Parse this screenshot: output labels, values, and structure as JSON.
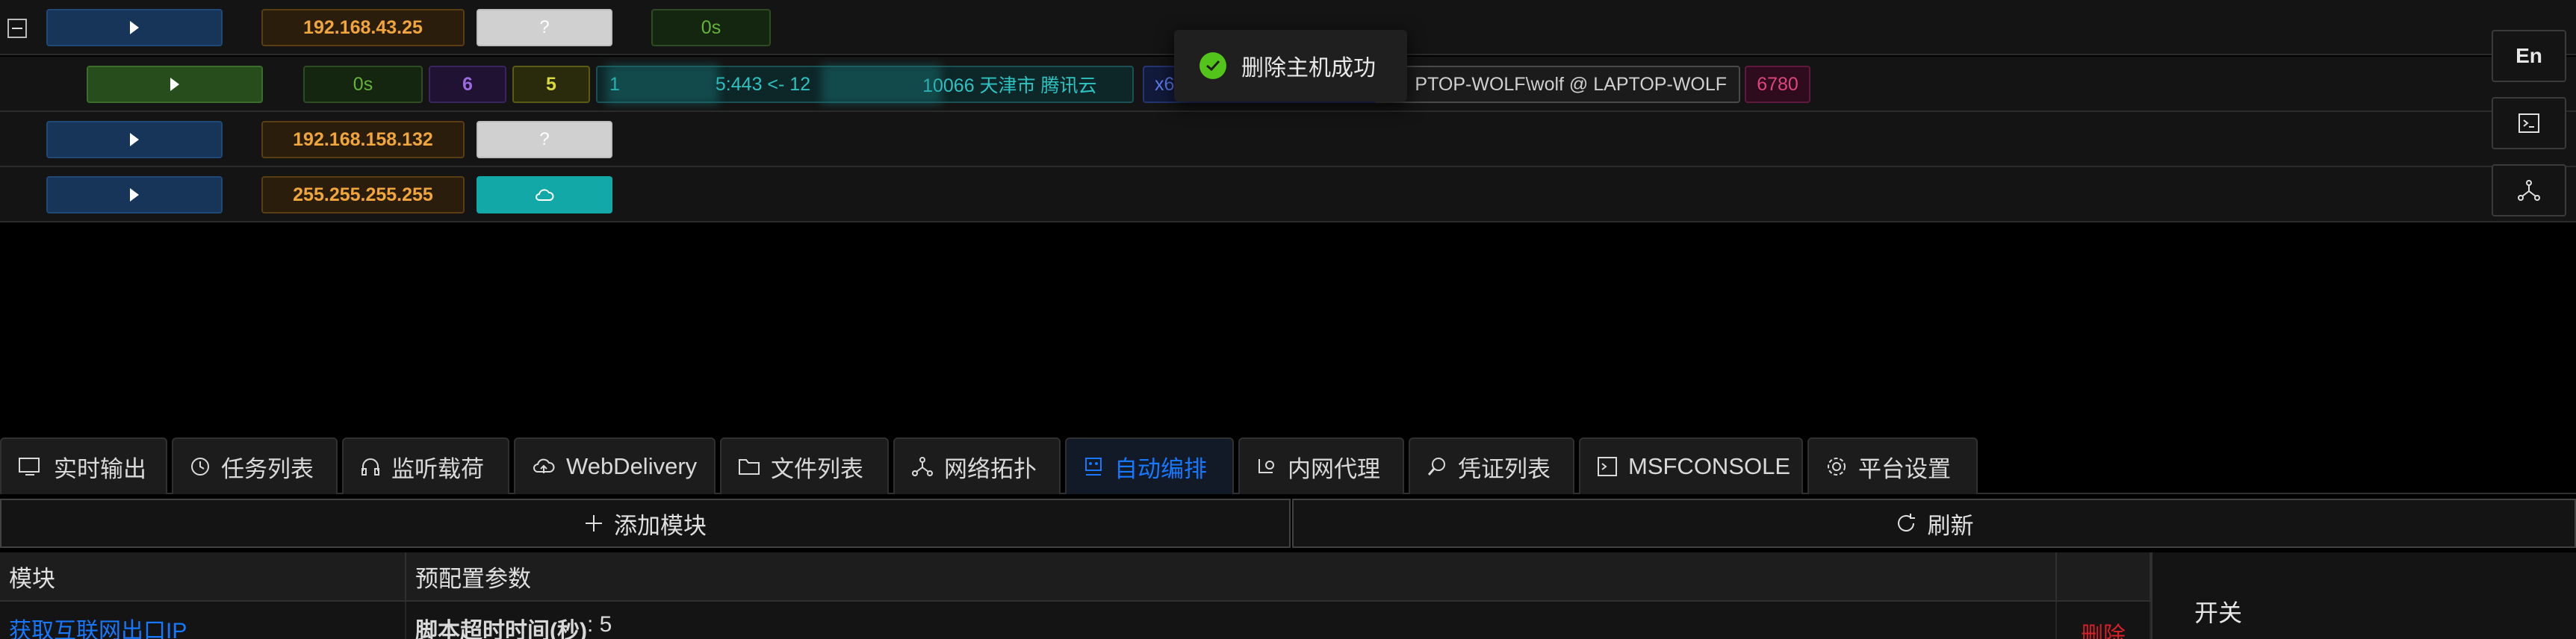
{
  "hosts": [
    {
      "ip": "192.168.43.25",
      "os": "?",
      "time": "0s"
    },
    {
      "session": {
        "time": "0s",
        "a": "6",
        "b": "5",
        "addr_prefix": "1",
        "addr_mid": "5:443 <- 12",
        "addr_suffix": "10066 天津市 腾讯云",
        "arch": "x6",
        "user": "PTOP-WOLF\\wolf @ LAPTOP-WOLF",
        "pid": "6780"
      }
    },
    {
      "ip": "192.168.158.132",
      "os": "?"
    },
    {
      "ip": "255.255.255.255",
      "os": "cloud"
    }
  ],
  "toast": {
    "text": "删除主机成功"
  },
  "side": {
    "lang": "En"
  },
  "tabs": [
    {
      "label": "实时输出"
    },
    {
      "label": "任务列表"
    },
    {
      "label": "监听载荷"
    },
    {
      "label": "WebDelivery"
    },
    {
      "label": "文件列表"
    },
    {
      "label": "网络拓扑"
    },
    {
      "label": "自动编排",
      "active": true
    },
    {
      "label": "内网代理"
    },
    {
      "label": "凭证列表"
    },
    {
      "label": "MSFCONSOLE"
    },
    {
      "label": "平台设置"
    }
  ],
  "toolbar": {
    "add": "添加模块",
    "refresh": "刷新"
  },
  "table": {
    "headers": [
      "模块",
      "预配置参数"
    ],
    "rows": [
      {
        "module": "获取互联网出口IP",
        "param_key": "脚本超时时间(秒)",
        "param_val": " : 5",
        "action": "删除"
      }
    ]
  },
  "panel": {
    "switch_label": "开关"
  },
  "colors": {
    "accent": "#1677ff",
    "success": "#52c41a",
    "danger": "#d32029"
  }
}
